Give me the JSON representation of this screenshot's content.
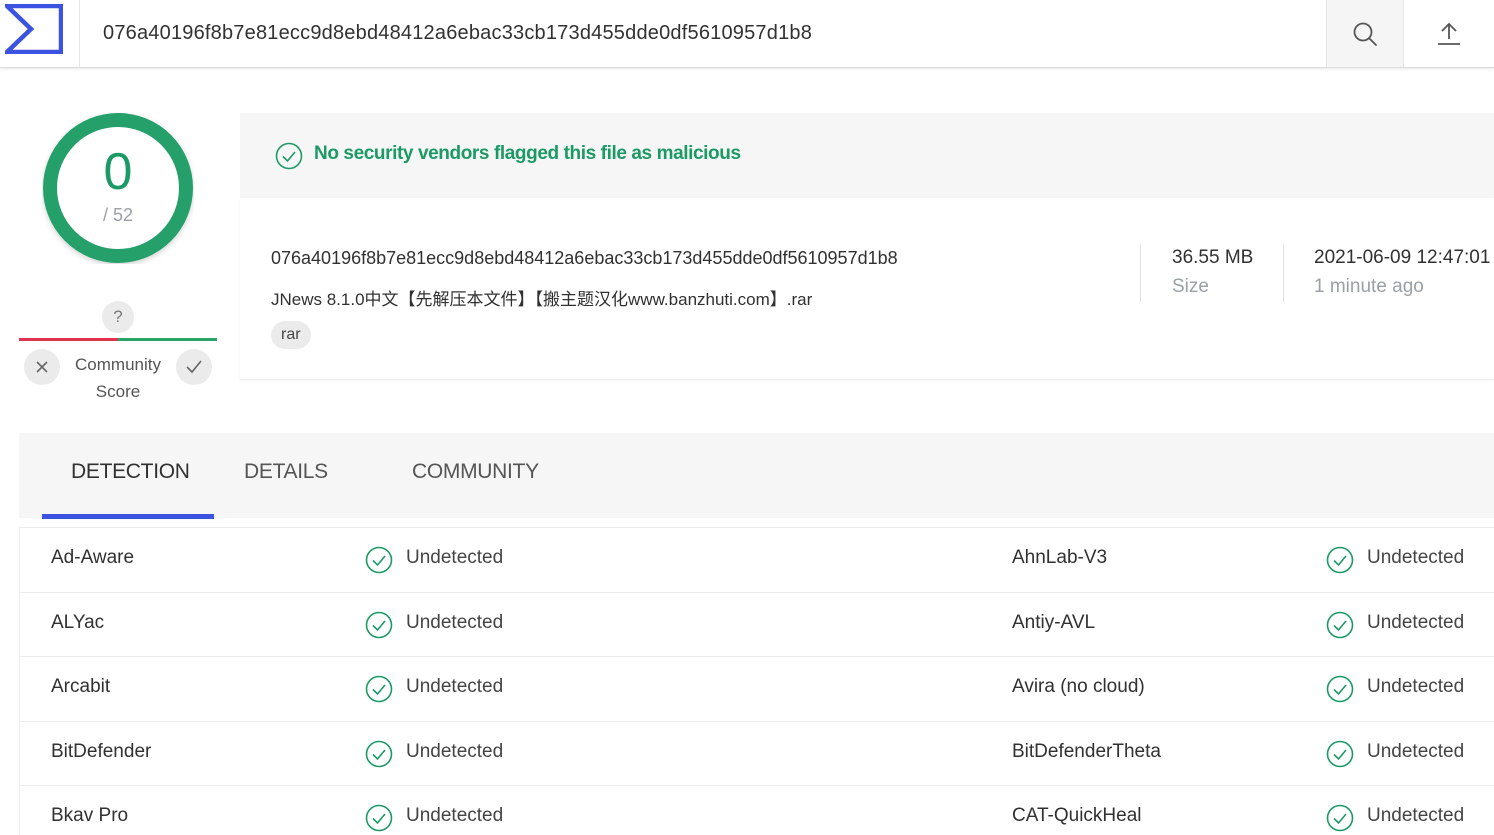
{
  "search": {
    "value": "076a40196f8b7e81ecc9d8ebd48412a6ebac33cb173d455dde0df5610957d1b8"
  },
  "colors": {
    "accent": "#3b53e0",
    "clean": "#1c9a66",
    "malicious": "#e0334f"
  },
  "score": {
    "detections": "0",
    "total": "/ 52"
  },
  "community": {
    "question": "?",
    "label_line1": "Community",
    "label_line2": "Score"
  },
  "banner": {
    "text": "No security vendors flagged this file as malicious"
  },
  "file": {
    "hash": "076a40196f8b7e81ecc9d8ebd48412a6ebac33cb173d455dde0df5610957d1b8",
    "name": "JNews 8.1.0中文【先解压本文件】【搬主题汉化www.banzhuti.com】.rar",
    "tag": "rar",
    "size_value": "36.55 MB",
    "size_label": "Size",
    "date_value": "2021-06-09 12:47:01",
    "date_label": "1 minute ago"
  },
  "tabs": [
    {
      "label": "DETECTION",
      "active": true
    },
    {
      "label": "DETAILS",
      "active": false
    },
    {
      "label": "COMMUNITY",
      "active": false
    }
  ],
  "detections": [
    {
      "left_vendor": "Ad-Aware",
      "left_result": "Undetected",
      "right_vendor": "AhnLab-V3",
      "right_result": "Undetected"
    },
    {
      "left_vendor": "ALYac",
      "left_result": "Undetected",
      "right_vendor": "Antiy-AVL",
      "right_result": "Undetected"
    },
    {
      "left_vendor": "Arcabit",
      "left_result": "Undetected",
      "right_vendor": "Avira (no cloud)",
      "right_result": "Undetected"
    },
    {
      "left_vendor": "BitDefender",
      "left_result": "Undetected",
      "right_vendor": "BitDefenderTheta",
      "right_result": "Undetected"
    },
    {
      "left_vendor": "Bkav Pro",
      "left_result": "Undetected",
      "right_vendor": "CAT-QuickHeal",
      "right_result": "Undetected"
    }
  ]
}
